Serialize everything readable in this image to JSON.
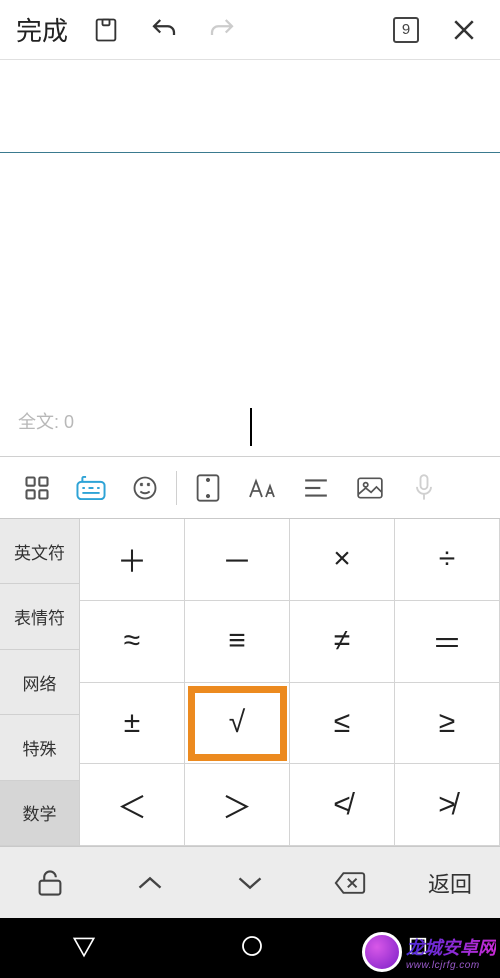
{
  "topbar": {
    "done": "完成",
    "badge": "9"
  },
  "editor": {
    "word_count": "全文: 0"
  },
  "categories": [
    "英文符",
    "表情符",
    "网络",
    "特殊",
    "数学"
  ],
  "active_category_index": 4,
  "symbols": [
    "＋",
    "－",
    "×",
    "÷",
    "≈",
    "≡",
    "≠",
    "＝",
    "±",
    "√",
    "≤",
    "≥",
    "＜",
    "＞",
    "≮",
    "≯"
  ],
  "highlighted_symbol_index": 9,
  "bottombar": {
    "return": "返回"
  },
  "watermark": {
    "main": "龙城安卓网",
    "sub": "www.lcjrfg.com"
  }
}
